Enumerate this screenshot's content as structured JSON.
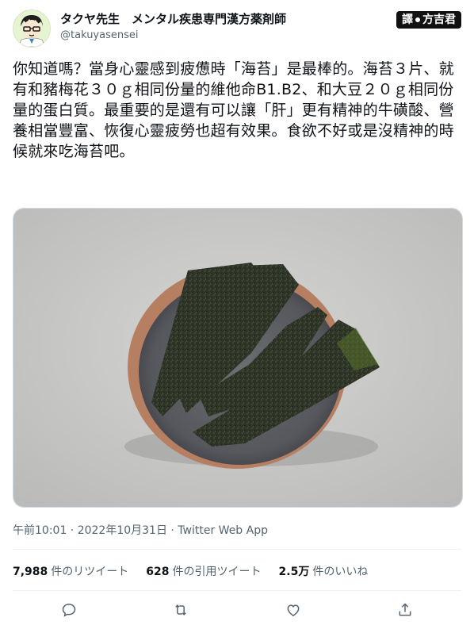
{
  "author": {
    "display_name": "タクヤ先生　メンタル疾患専門漢方薬剤師",
    "handle": "@takuyasensei"
  },
  "translator_badge": {
    "prefix": "譯",
    "name": "方吉君"
  },
  "tweet": {
    "text": "你知道嗎？當身心靈感到疲憊時「海苔」是最棒的。海苔３片、就有和豬梅花３０ｇ相同份量的維他命B1.B2、和大豆２０ｇ相同份量的蛋白質。最重要的是還有可以讓「肝」更有精神的牛磺酸、營養相當豐富、恢復心靈疲勞也超有效果。食欲不好或是沒精神的時候就來吃海苔吧。"
  },
  "meta": {
    "text": "午前10:01 · 2022年10月31日 · Twitter Web App"
  },
  "stats": {
    "retweets_count": "7,988",
    "retweets_label": "件のリツイート",
    "quotes_count": "628",
    "quotes_label": "件の引用ツイート",
    "likes_count": "2.5万",
    "likes_label": "件のいいね"
  },
  "icons": [
    "reply-icon",
    "retweet-icon",
    "like-icon",
    "share-icon"
  ],
  "colors": {
    "text": "#0f1419",
    "secondary": "#536471",
    "divider": "#eff3f4"
  }
}
